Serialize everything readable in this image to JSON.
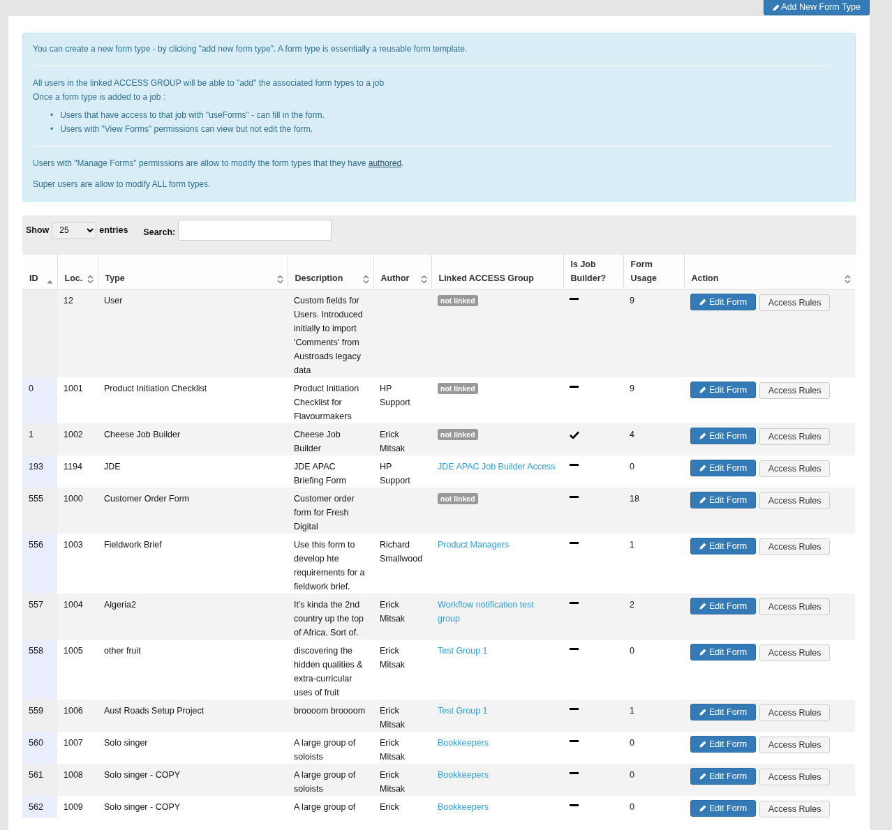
{
  "header": {
    "add_button": "Add New Form Type"
  },
  "info": {
    "intro": "You can create a new form type - by clicking \"add new form type\". A form type is essentially a reusable form template.",
    "access_lines": [
      "All users in the linked ACCESS GROUP will be able to \"add\" the associated form types to a job",
      "Once a form type is added to a job :"
    ],
    "bullets": [
      {
        "marker": "•",
        "text": "Users that have access to that job with \"useForms\" - can fill in the form."
      },
      {
        "marker": "•",
        "text": "Users with \"View Forms\" permissions can view but not edit the form."
      }
    ],
    "manage_text": "Users with \"Manage Forms\" permissions are allow to modify the form types that they have",
    "manage_link": "authored",
    "manage_end": ".",
    "super_text": "Super users are allow to modify ALL form types."
  },
  "controls": {
    "show_label": "Show",
    "page_size": "25",
    "entries_label": "entries",
    "search_label": "Search:"
  },
  "table": {
    "columns": [
      {
        "label": "ID",
        "sortable": true,
        "sorted": true
      },
      {
        "label": "Loc.",
        "sortable": true,
        "sorted": false
      },
      {
        "label": "Type",
        "sortable": true,
        "sorted": false
      },
      {
        "label": "Description",
        "sortable": true,
        "sorted": false
      },
      {
        "label": "Author",
        "sortable": true,
        "sorted": false
      },
      {
        "label": "Linked ACCESS Group",
        "sortable": false,
        "sorted": false
      },
      {
        "label": "Is Job Builder?",
        "sortable": false,
        "sorted": false
      },
      {
        "label": "Form Usage",
        "sortable": false,
        "sorted": false
      },
      {
        "label": "Action",
        "sortable": true,
        "sorted": false
      }
    ],
    "rows": [
      {
        "id": "",
        "loc": "12",
        "type": "User",
        "description": "Custom fields for Users. Introduced initially to import 'Comments' from Austroads legacy data",
        "author": "",
        "group": {
          "kind": "badge",
          "text": "not linked"
        },
        "job_builder": false,
        "usage": "9",
        "edit": "Edit Form",
        "access": "Access Rules"
      },
      {
        "id": "0",
        "loc": "1001",
        "type": "Product Initiation Checklist",
        "description": "Product Initiation Checklist for Flavourmakers",
        "author": "HP Support",
        "group": {
          "kind": "badge",
          "text": "not linked"
        },
        "job_builder": false,
        "usage": "9",
        "edit": "Edit Form",
        "access": "Access Rules"
      },
      {
        "id": "1",
        "loc": "1002",
        "type": "Cheese Job Builder",
        "description": "Cheese Job Builder",
        "author": "Erick Mitsak",
        "group": {
          "kind": "badge",
          "text": "not linked"
        },
        "job_builder": true,
        "usage": "4",
        "edit": "Edit Form",
        "access": "Access Rules"
      },
      {
        "id": "193",
        "loc": "1194",
        "type": "JDE",
        "description": "JDE APAC Briefing Form",
        "author": "HP Support",
        "group": {
          "kind": "link",
          "text": "JDE APAC Job Builder Access"
        },
        "job_builder": false,
        "usage": "0",
        "edit": "Edit Form",
        "access": "Access Rules"
      },
      {
        "id": "555",
        "loc": "1000",
        "type": "Customer Order Form",
        "description": "Customer order form for Fresh Digital",
        "author": "",
        "group": {
          "kind": "badge",
          "text": "not linked"
        },
        "job_builder": false,
        "usage": "18",
        "edit": "Edit Form",
        "access": "Access Rules"
      },
      {
        "id": "556",
        "loc": "1003",
        "type": "Fieldwork Brief",
        "description": "Use this form to develop hte requirements for a fieldwork brief.",
        "author": "Richard Smallwood",
        "group": {
          "kind": "link",
          "text": "Product Managers"
        },
        "job_builder": false,
        "usage": "1",
        "edit": "Edit Form",
        "access": "Access Rules"
      },
      {
        "id": "557",
        "loc": "1004",
        "type": "Algeria2",
        "description": "It's kinda the 2nd country up the top of Africa. Sort of.",
        "author": "Erick Mitsak",
        "group": {
          "kind": "link",
          "text": "Workflow notification test group"
        },
        "job_builder": false,
        "usage": "2",
        "edit": "Edit Form",
        "access": "Access Rules"
      },
      {
        "id": "558",
        "loc": "1005",
        "type": "other fruit",
        "description": "discovering the hidden qualities & extra-curricular uses of fruit",
        "author": "Erick Mitsak",
        "group": {
          "kind": "link",
          "text": "Test Group 1"
        },
        "job_builder": false,
        "usage": "0",
        "edit": "Edit Form",
        "access": "Access Rules"
      },
      {
        "id": "559",
        "loc": "1006",
        "type": "Aust Roads Setup Project",
        "description": "broooom broooom",
        "author": "Erick Mitsak",
        "group": {
          "kind": "link",
          "text": "Test Group 1"
        },
        "job_builder": false,
        "usage": "1",
        "edit": "Edit Form",
        "access": "Access Rules"
      },
      {
        "id": "560",
        "loc": "1007",
        "type": "Solo singer",
        "description": "A large group of soloists",
        "author": "Erick Mitsak",
        "group": {
          "kind": "link",
          "text": "Bookkeepers"
        },
        "job_builder": false,
        "usage": "0",
        "edit": "Edit Form",
        "access": "Access Rules"
      },
      {
        "id": "561",
        "loc": "1008",
        "type": "Solo singer - COPY",
        "description": "A large group of soloists",
        "author": "Erick Mitsak",
        "group": {
          "kind": "link",
          "text": "Bookkeepers"
        },
        "job_builder": false,
        "usage": "0",
        "edit": "Edit Form",
        "access": "Access Rules"
      },
      {
        "id": "562",
        "loc": "1009",
        "type": "Solo singer - COPY",
        "description": "A large group of",
        "author": "Erick",
        "group": {
          "kind": "link",
          "text": "Bookkeepers"
        },
        "job_builder": false,
        "usage": "0",
        "edit": "Edit Form",
        "access": "Access Rules"
      }
    ]
  }
}
